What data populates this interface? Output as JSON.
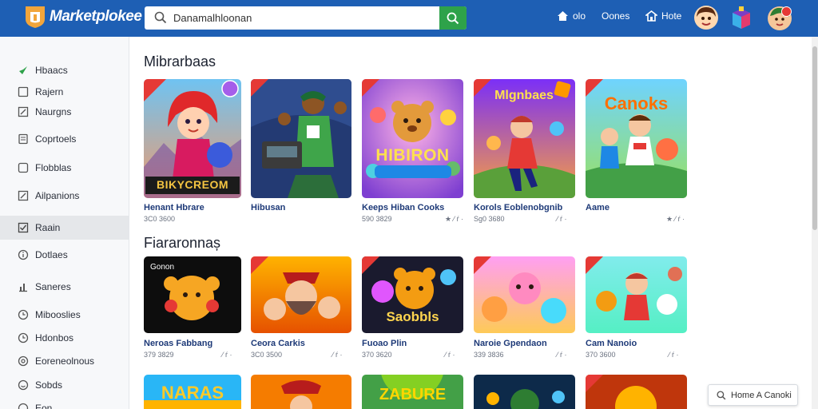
{
  "app": {
    "brand": "Marketplokee",
    "logo_icon": "shield-logo-icon"
  },
  "colors": {
    "header": "#1e5fb4",
    "search_button": "#2ea24a",
    "title_text": "#1e3a78"
  },
  "search": {
    "value": "Danamalhloonan",
    "placeholder": ""
  },
  "header_nav": [
    {
      "label": "olo",
      "icon": "home-icon"
    },
    {
      "label": "Oones",
      "icon": ""
    },
    {
      "label": "Hote",
      "icon": "store-icon"
    }
  ],
  "sidebar": {
    "items": [
      {
        "label": "Hbaacs",
        "icon": "check-icon"
      },
      {
        "label": "Rajern",
        "icon": "square-icon"
      },
      {
        "label": "Naurgns",
        "icon": "edit-icon"
      },
      {
        "label": "Coprtoels",
        "icon": "document-icon"
      },
      {
        "label": "Flobblas",
        "icon": "square-icon"
      },
      {
        "label": "Ailpanions",
        "icon": "edit-icon"
      },
      {
        "label": "Raain",
        "icon": "checkbox-icon"
      },
      {
        "label": "Dotlaes",
        "icon": "info-icon"
      },
      {
        "label": "Saneres",
        "icon": "chart-icon"
      },
      {
        "label": "Mibooslies",
        "icon": "clock-icon"
      },
      {
        "label": "Hdonbos",
        "icon": "clock-icon"
      },
      {
        "label": "Eoreneolnous",
        "icon": "settings-icon"
      },
      {
        "label": "Sobds",
        "icon": "smile-icon"
      },
      {
        "label": "Eon",
        "icon": "clock-icon"
      }
    ]
  },
  "sections": [
    {
      "title": "Mibrarbaas",
      "games": [
        {
          "title": "Henant Hbrare",
          "meta": "3C0 3600",
          "rating": "",
          "banner": "BIKYCREOM"
        },
        {
          "title": "Hibusan",
          "meta": "",
          "rating": "",
          "banner": ""
        },
        {
          "title": "Keeps Hiban Cooks",
          "meta": "590 3829",
          "rating": "★ ⁄ ŕ ·",
          "banner": "HIBIRON"
        },
        {
          "title": "Korols Eoblenobgnib",
          "meta": "Sg0 3680",
          "rating": "⁄ ŕ ·",
          "banner": "Mlgnbaes"
        },
        {
          "title": "Aame",
          "meta": "",
          "rating": "★ ⁄ ŕ ·",
          "banner": "Canoks"
        }
      ]
    },
    {
      "title": "Fiararonnaș",
      "games": [
        {
          "title": "Neroas Fabbang",
          "meta": "379 3829",
          "rating": "⁄ ŕ ·",
          "banner": ""
        },
        {
          "title": "Ceora Carkis",
          "meta": "3C0 3500",
          "rating": "⁄ ŕ ·",
          "banner": ""
        },
        {
          "title": "Fuoao Plin",
          "meta": "370 3620",
          "rating": "⁄ ŕ ·",
          "banner": "Saobbls"
        },
        {
          "title": "Naroie Gpendaon",
          "meta": "339 3836",
          "rating": "⁄ ŕ ·",
          "banner": ""
        },
        {
          "title": "Cam Nanoio",
          "meta": "370 3600",
          "rating": "⁄ ŕ ·",
          "banner": ""
        }
      ]
    },
    {
      "title": "",
      "games": [
        {
          "title": "",
          "meta": "",
          "rating": "",
          "banner": "NARAS"
        },
        {
          "title": "",
          "meta": "",
          "rating": "",
          "banner": ""
        },
        {
          "title": "",
          "meta": "",
          "rating": "",
          "banner": "ZABURE"
        },
        {
          "title": "",
          "meta": "",
          "rating": "",
          "banner": ""
        },
        {
          "title": "",
          "meta": "",
          "rating": "",
          "banner": ""
        }
      ]
    }
  ],
  "floating_button": {
    "label": "Home A Canoki",
    "icon": "search-icon"
  }
}
